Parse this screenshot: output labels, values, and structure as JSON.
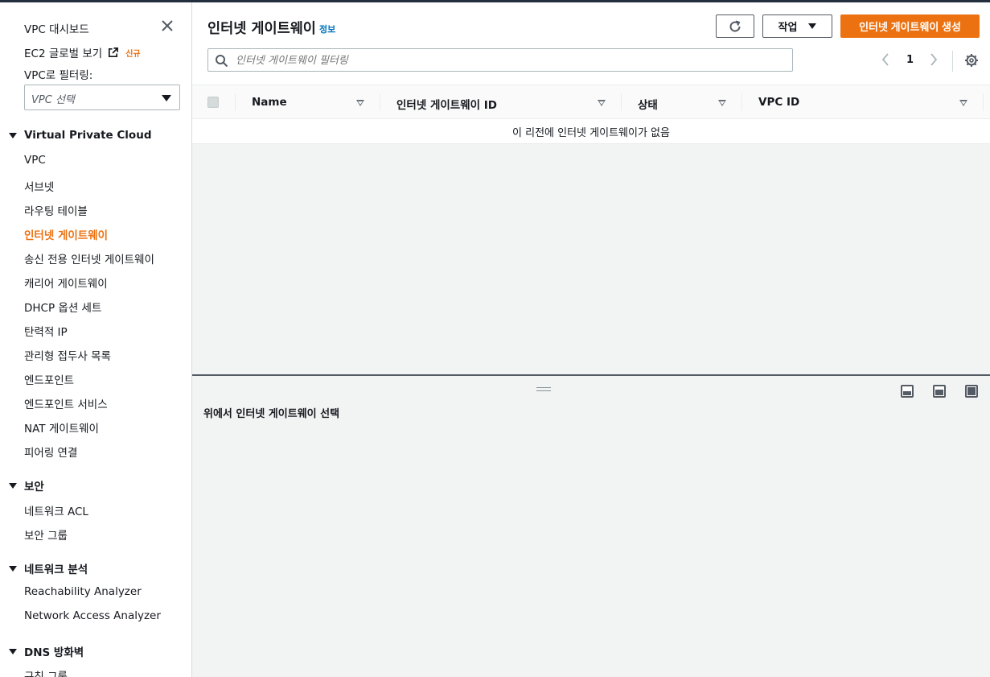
{
  "sidebar": {
    "dashboard": "VPC 대시보드",
    "ec2_global": "EC2 글로벌 보기",
    "new_badge": "신규",
    "filter_label": "VPC로 필터링:",
    "filter_placeholder": "VPC 선택",
    "sections": [
      {
        "title": "Virtual Private Cloud"
      },
      {
        "title": "보안"
      },
      {
        "title": "네트워크 분석"
      },
      {
        "title": "DNS 방화벽"
      }
    ],
    "vpc_items": [
      "VPC",
      "서브넷",
      "라우팅 테이블",
      "인터넷 게이트웨이",
      "송신 전용 인터넷 게이트웨이",
      "캐리어 게이트웨이",
      "DHCP 옵션 세트",
      "탄력적 IP",
      "관리형 접두사 목록",
      "엔드포인트",
      "엔드포인트 서비스",
      "NAT 게이트웨이",
      "피어링 연결"
    ],
    "security_items": [
      "네트워크 ACL",
      "보안 그룹"
    ],
    "analysis_items": [
      "Reachability Analyzer",
      "Network Access Analyzer"
    ],
    "dns_items": [
      "규칙 그룹"
    ],
    "active_item": "인터넷 게이트웨이"
  },
  "main": {
    "title": "인터넷 게이트웨이",
    "info": "정보",
    "actions_label": "작업",
    "create_label": "인터넷 게이트웨이 생성",
    "search_placeholder": "인터넷 게이트웨이 필터링",
    "page": "1",
    "columns": [
      "Name",
      "인터넷 게이트웨이 ID",
      "상태",
      "VPC ID"
    ],
    "empty_message": "이 리전에 인터넷 게이트웨이가 없음",
    "detail_message": "위에서 인터넷 게이트웨이 선택"
  },
  "colors": {
    "accent": "#ec7211",
    "link": "#0073bb",
    "navy": "#232f3e"
  }
}
